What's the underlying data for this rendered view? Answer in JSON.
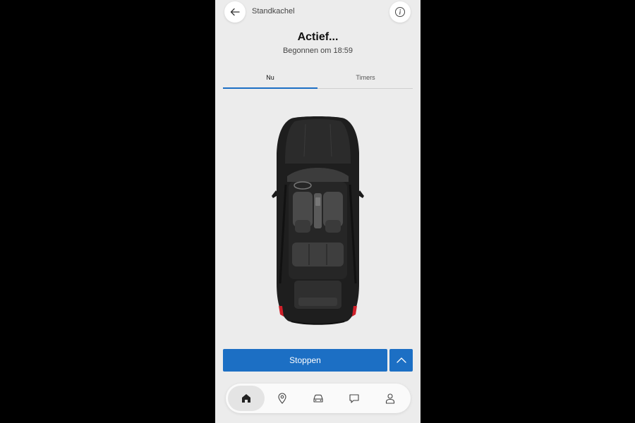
{
  "header": {
    "title": "Standkachel",
    "back_icon": "arrow-left-icon",
    "info_icon": "info-icon"
  },
  "status": {
    "title": "Actief...",
    "subtitle": "Begonnen om 18:59"
  },
  "tabs": [
    {
      "label": "Nu",
      "active": true
    },
    {
      "label": "Timers",
      "active": false
    }
  ],
  "actions": {
    "stop_label": "Stoppen",
    "expand_icon": "chevron-up-icon"
  },
  "bottom_nav": [
    {
      "icon": "home-icon",
      "active": true
    },
    {
      "icon": "location-pin-icon",
      "active": false
    },
    {
      "icon": "car-icon",
      "active": false
    },
    {
      "icon": "chat-icon",
      "active": false
    },
    {
      "icon": "profile-icon",
      "active": false
    }
  ],
  "colors": {
    "accent": "#1c6fc4",
    "background": "#ececec",
    "car_body": "#1e1e1e",
    "tail_light": "#d0202a"
  }
}
